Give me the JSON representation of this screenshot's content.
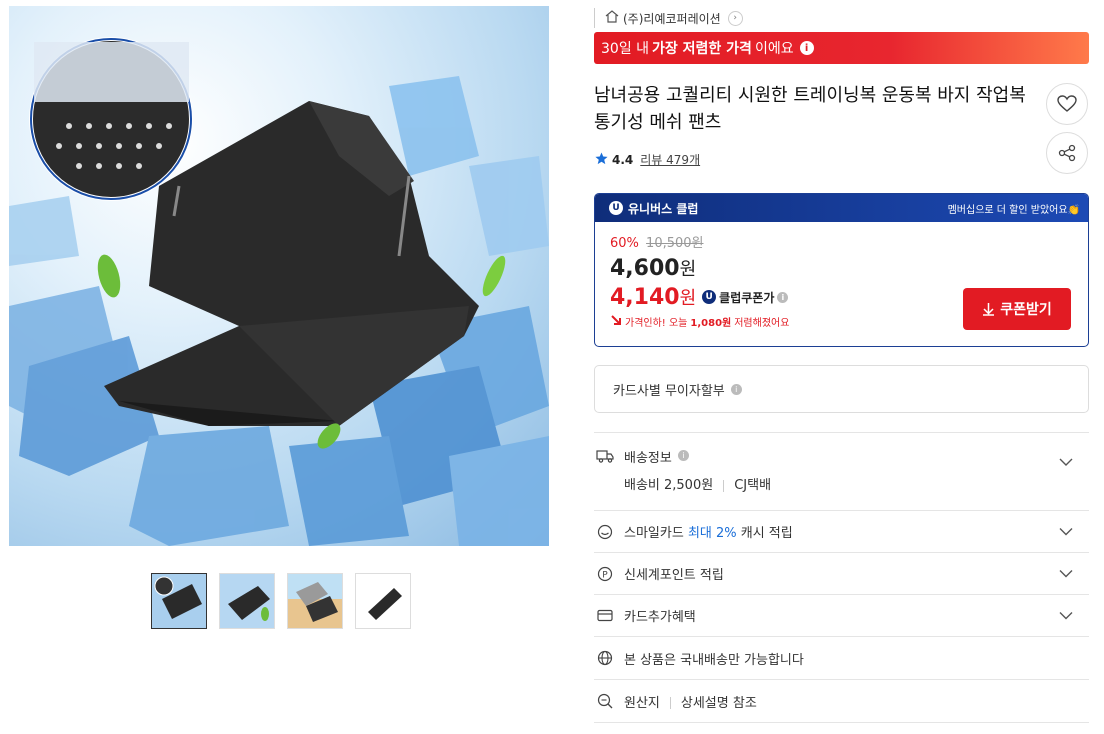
{
  "seller": {
    "name": "(주)리예코퍼레이션"
  },
  "promo": {
    "prefix": "30일 내 ",
    "highlight": "가장 저렴한 가격",
    "suffix": "이에요"
  },
  "product": {
    "title": "남녀공용 고퀄리티 시원한 트레이닝복 운동복 바지 작업복 통기성 메쉬 팬츠",
    "rating": "4.4",
    "reviews": "리뷰 479개"
  },
  "club": {
    "name": "유니버스 클럽",
    "note": "멤버십으로 더 할인 받았어요👏",
    "discount_rate": "60%",
    "original_price": "10,500원",
    "price_num": "4,600",
    "coupon_price_num": "4,140",
    "won": "원",
    "coupon_label": "클럽쿠폰가",
    "drop_prefix": "가격인하! 오늘 ",
    "drop_amount": "1,080원",
    "drop_suffix": " 저렴해졌어요",
    "coupon_button": "쿠폰받기"
  },
  "installment": {
    "label": "카드사별 무이자할부"
  },
  "shipping": {
    "label": "배송정보",
    "fee": "배송비 2,500원",
    "carrier": "CJ택배"
  },
  "benefits": {
    "smile_prefix": "스마일카드 ",
    "smile_highlight": "최대 2%",
    "smile_suffix": " 캐시 적립",
    "shinsegae": "신세계포인트 적립",
    "card_extra": "카드추가혜택",
    "domestic": "본 상품은 국내배송만 가능합니다",
    "origin_label": "원산지",
    "origin_value": "상세설명 참조"
  },
  "colors": {
    "accent_red": "#e21b23",
    "club_navy": "#0f2d7a",
    "link_blue": "#1a6ed8"
  },
  "icons": [
    "home-icon",
    "chevron-right-icon",
    "info-icon",
    "heart-icon",
    "share-icon",
    "star-icon",
    "download-icon",
    "truck-icon",
    "smile-card-icon",
    "point-icon",
    "card-icon",
    "globe-icon",
    "search-origin-icon",
    "chevron-down-icon"
  ]
}
